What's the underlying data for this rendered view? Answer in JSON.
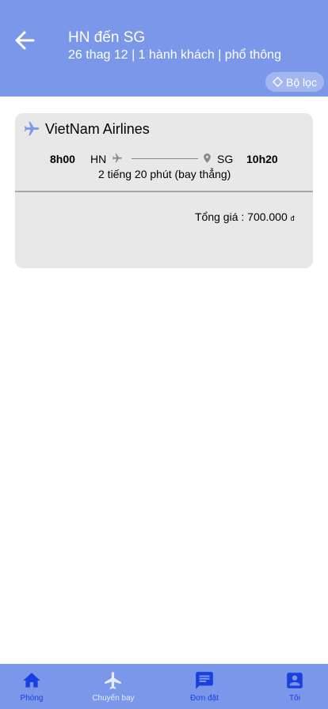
{
  "header": {
    "title": "HN đến SG",
    "subtitle": "26 thag 12 | 1 hành khách | phổ thông",
    "filter_label": "Bộ lọc"
  },
  "flight": {
    "airline": "VietNam Airlines",
    "departure_time": "8h00",
    "from": "HN",
    "to": "SG",
    "arrival_time": "10h20",
    "duration": "2 tiếng 20 phút (bay thẳng)",
    "total_label": "Tổng giá : 700.000",
    "currency": "đ"
  },
  "nav": {
    "items": [
      {
        "label": "Phòng",
        "icon": "home-icon",
        "active": true
      },
      {
        "label": "Chuyến bay",
        "icon": "airplane-icon",
        "active": false
      },
      {
        "label": "Đơn đặt",
        "icon": "message-icon",
        "active": true
      },
      {
        "label": "Tôi",
        "icon": "account-icon",
        "active": true
      }
    ]
  },
  "colors": {
    "header_bg": "#7a97ea",
    "card_bg": "#e8e8e8",
    "nav_active": "#1a3fe0",
    "nav_inactive": "#e6ecfc"
  }
}
